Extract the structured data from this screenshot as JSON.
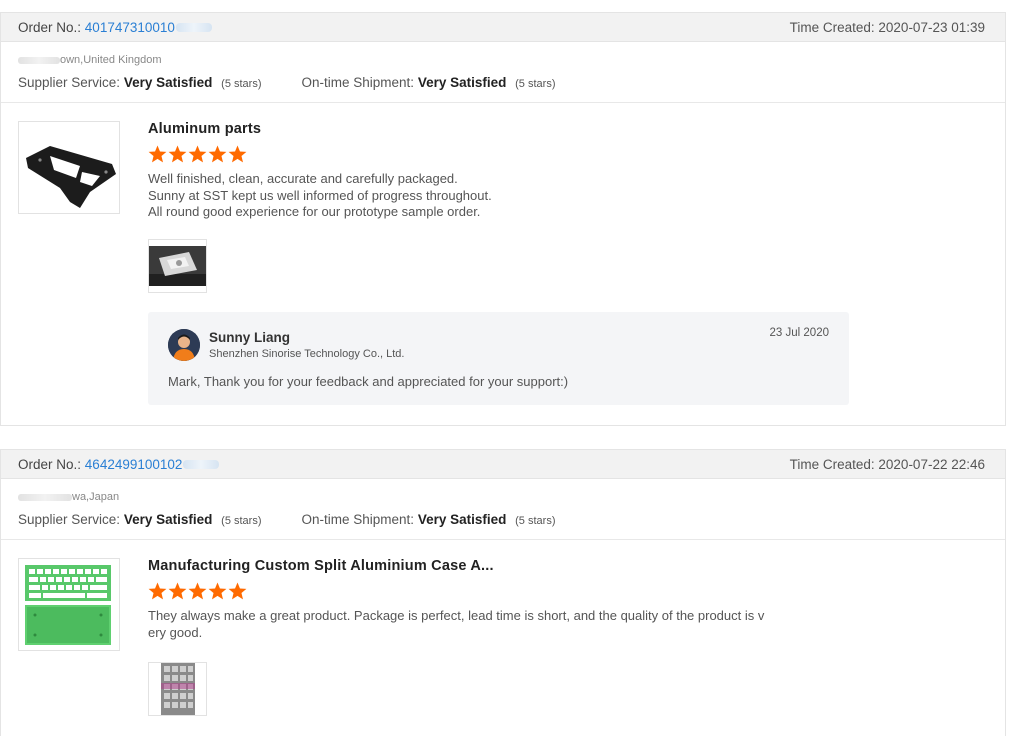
{
  "reviews": [
    {
      "order_label": "Order No.:",
      "order_number": "401747310010",
      "time_label": "Time Created:",
      "time_created": "2020-07-23 01:39",
      "location": "own,United Kingdom",
      "supplier_service_label": "Supplier Service:",
      "supplier_service_value": "Very Satisfied",
      "supplier_service_stars": "(5 stars)",
      "shipment_label": "On-time Shipment:",
      "shipment_value": "Very Satisfied",
      "shipment_stars": "(5 stars)",
      "product_title": "Aluminum parts",
      "rating": 5,
      "review_text": "Well finished, clean, accurate and carefully packaged.\nSunny at SST kept us well informed of progress throughout.\nAll round good experience for our prototype sample order.",
      "reply": {
        "name": "Sunny Liang",
        "company": "Shenzhen Sinorise Technology Co., Ltd.",
        "date": "23 Jul 2020",
        "text": "Mark, Thank you for your feedback and appreciated for your support:)"
      }
    },
    {
      "order_label": "Order No.:",
      "order_number": "4642499100102",
      "time_label": "Time Created:",
      "time_created": "2020-07-22 22:46",
      "location": "wa,Japan",
      "supplier_service_label": "Supplier Service:",
      "supplier_service_value": "Very Satisfied",
      "supplier_service_stars": "(5 stars)",
      "shipment_label": "On-time Shipment:",
      "shipment_value": "Very Satisfied",
      "shipment_stars": "(5 stars)",
      "product_title": "Manufacturing Custom Split Aluminium Case A...",
      "rating": 5,
      "review_text": "They always make a great product. Package is perfect, lead time is short, and the quality of the product is v\nery good."
    }
  ],
  "colors": {
    "link": "#2a7fd4",
    "star": "#ff6a00",
    "header_bg": "#f2f2f2",
    "reply_bg": "#f4f5f7"
  },
  "icons": {
    "star": "star-icon",
    "avatar": "avatar"
  }
}
